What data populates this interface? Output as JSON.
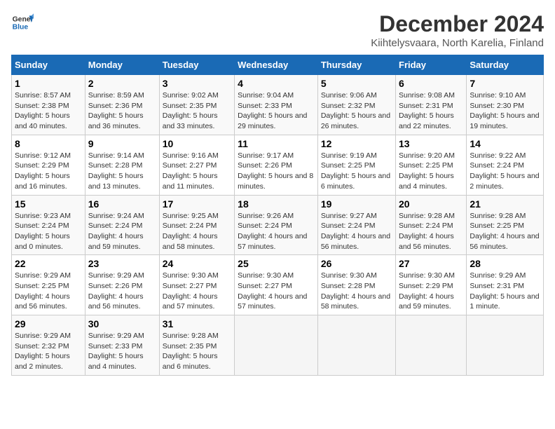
{
  "header": {
    "logo_line1": "General",
    "logo_line2": "Blue",
    "title": "December 2024",
    "subtitle": "Kiihtelysvaara, North Karelia, Finland"
  },
  "days_of_week": [
    "Sunday",
    "Monday",
    "Tuesday",
    "Wednesday",
    "Thursday",
    "Friday",
    "Saturday"
  ],
  "weeks": [
    [
      {
        "day": "1",
        "sunrise": "8:57 AM",
        "sunset": "2:38 PM",
        "daylight": "5 hours and 40 minutes."
      },
      {
        "day": "2",
        "sunrise": "8:59 AM",
        "sunset": "2:36 PM",
        "daylight": "5 hours and 36 minutes."
      },
      {
        "day": "3",
        "sunrise": "9:02 AM",
        "sunset": "2:35 PM",
        "daylight": "5 hours and 33 minutes."
      },
      {
        "day": "4",
        "sunrise": "9:04 AM",
        "sunset": "2:33 PM",
        "daylight": "5 hours and 29 minutes."
      },
      {
        "day": "5",
        "sunrise": "9:06 AM",
        "sunset": "2:32 PM",
        "daylight": "5 hours and 26 minutes."
      },
      {
        "day": "6",
        "sunrise": "9:08 AM",
        "sunset": "2:31 PM",
        "daylight": "5 hours and 22 minutes."
      },
      {
        "day": "7",
        "sunrise": "9:10 AM",
        "sunset": "2:30 PM",
        "daylight": "5 hours and 19 minutes."
      }
    ],
    [
      {
        "day": "8",
        "sunrise": "9:12 AM",
        "sunset": "2:29 PM",
        "daylight": "5 hours and 16 minutes."
      },
      {
        "day": "9",
        "sunrise": "9:14 AM",
        "sunset": "2:28 PM",
        "daylight": "5 hours and 13 minutes."
      },
      {
        "day": "10",
        "sunrise": "9:16 AM",
        "sunset": "2:27 PM",
        "daylight": "5 hours and 11 minutes."
      },
      {
        "day": "11",
        "sunrise": "9:17 AM",
        "sunset": "2:26 PM",
        "daylight": "5 hours and 8 minutes."
      },
      {
        "day": "12",
        "sunrise": "9:19 AM",
        "sunset": "2:25 PM",
        "daylight": "5 hours and 6 minutes."
      },
      {
        "day": "13",
        "sunrise": "9:20 AM",
        "sunset": "2:25 PM",
        "daylight": "5 hours and 4 minutes."
      },
      {
        "day": "14",
        "sunrise": "9:22 AM",
        "sunset": "2:24 PM",
        "daylight": "5 hours and 2 minutes."
      }
    ],
    [
      {
        "day": "15",
        "sunrise": "9:23 AM",
        "sunset": "2:24 PM",
        "daylight": "5 hours and 0 minutes."
      },
      {
        "day": "16",
        "sunrise": "9:24 AM",
        "sunset": "2:24 PM",
        "daylight": "4 hours and 59 minutes."
      },
      {
        "day": "17",
        "sunrise": "9:25 AM",
        "sunset": "2:24 PM",
        "daylight": "4 hours and 58 minutes."
      },
      {
        "day": "18",
        "sunrise": "9:26 AM",
        "sunset": "2:24 PM",
        "daylight": "4 hours and 57 minutes."
      },
      {
        "day": "19",
        "sunrise": "9:27 AM",
        "sunset": "2:24 PM",
        "daylight": "4 hours and 56 minutes."
      },
      {
        "day": "20",
        "sunrise": "9:28 AM",
        "sunset": "2:24 PM",
        "daylight": "4 hours and 56 minutes."
      },
      {
        "day": "21",
        "sunrise": "9:28 AM",
        "sunset": "2:25 PM",
        "daylight": "4 hours and 56 minutes."
      }
    ],
    [
      {
        "day": "22",
        "sunrise": "9:29 AM",
        "sunset": "2:25 PM",
        "daylight": "4 hours and 56 minutes."
      },
      {
        "day": "23",
        "sunrise": "9:29 AM",
        "sunset": "2:26 PM",
        "daylight": "4 hours and 56 minutes."
      },
      {
        "day": "24",
        "sunrise": "9:30 AM",
        "sunset": "2:27 PM",
        "daylight": "4 hours and 57 minutes."
      },
      {
        "day": "25",
        "sunrise": "9:30 AM",
        "sunset": "2:27 PM",
        "daylight": "4 hours and 57 minutes."
      },
      {
        "day": "26",
        "sunrise": "9:30 AM",
        "sunset": "2:28 PM",
        "daylight": "4 hours and 58 minutes."
      },
      {
        "day": "27",
        "sunrise": "9:30 AM",
        "sunset": "2:29 PM",
        "daylight": "4 hours and 59 minutes."
      },
      {
        "day": "28",
        "sunrise": "9:29 AM",
        "sunset": "2:31 PM",
        "daylight": "5 hours and 1 minute."
      }
    ],
    [
      {
        "day": "29",
        "sunrise": "9:29 AM",
        "sunset": "2:32 PM",
        "daylight": "5 hours and 2 minutes."
      },
      {
        "day": "30",
        "sunrise": "9:29 AM",
        "sunset": "2:33 PM",
        "daylight": "5 hours and 4 minutes."
      },
      {
        "day": "31",
        "sunrise": "9:28 AM",
        "sunset": "2:35 PM",
        "daylight": "5 hours and 6 minutes."
      },
      null,
      null,
      null,
      null
    ]
  ],
  "labels": {
    "sunrise": "Sunrise:",
    "sunset": "Sunset:",
    "daylight": "Daylight:"
  }
}
